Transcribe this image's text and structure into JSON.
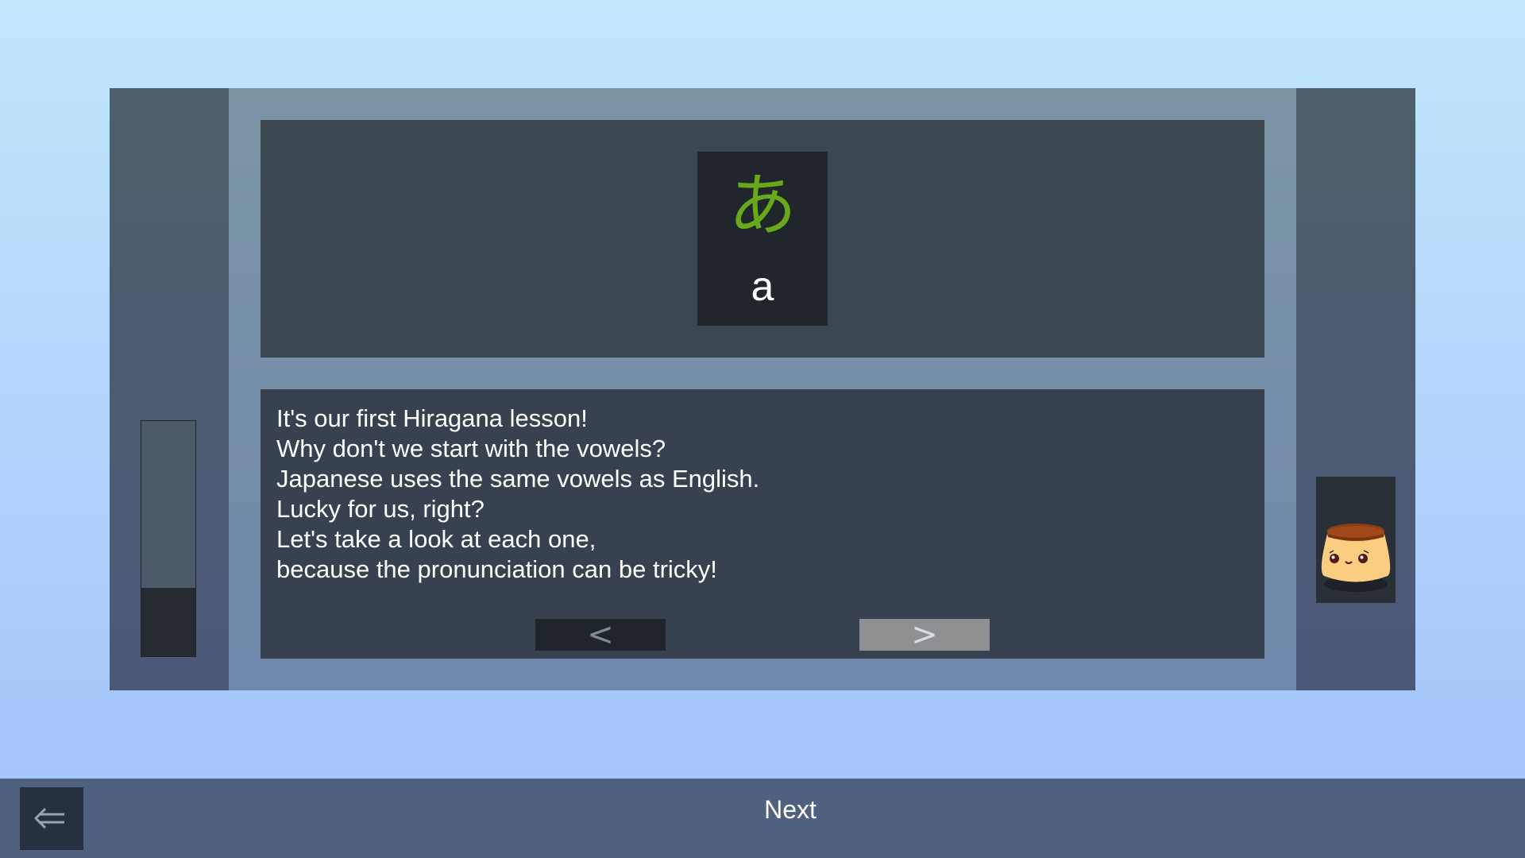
{
  "kana_card": {
    "character": "あ",
    "romaji": "a",
    "character_color": "#67a91a"
  },
  "lesson": {
    "lines": [
      "It's our first Hiragana lesson!",
      "Why don't we start with the vowels?",
      "Japanese uses the same vowels as English.",
      "Lucky for us, right?",
      "Let's take a look at each one,",
      "because the pronunciation can be tricky!"
    ],
    "prev_label": "<",
    "next_label": ">"
  },
  "progress": {
    "fraction": 0.29
  },
  "mascot": {
    "icon": "pudding-mascot-icon"
  },
  "bottom_bar": {
    "back_icon": "left-arrow-icon",
    "next_label": "Next"
  },
  "colors": {
    "background_top": "#c1e7fb",
    "background_bottom": "#a2c3fb",
    "panel": "#3c4851",
    "bottom_bar": "#506180"
  }
}
